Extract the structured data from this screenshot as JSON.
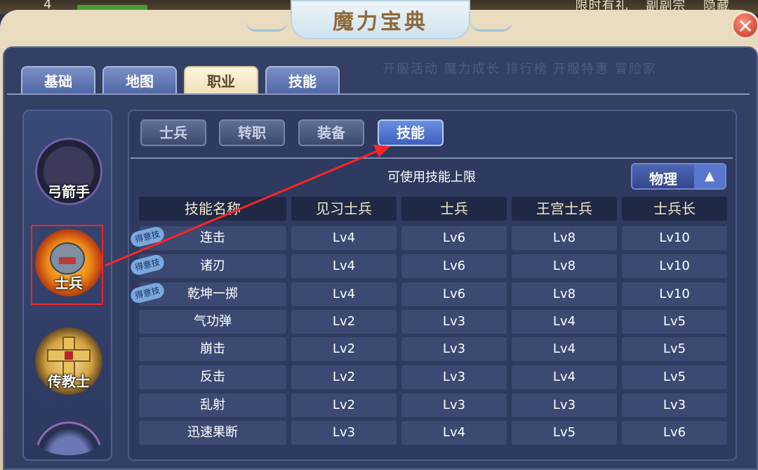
{
  "top_strip": {
    "number": "4",
    "menu": [
      "限时有礼",
      "副副宗",
      "隐藏"
    ]
  },
  "window": {
    "title": "魔力宝典",
    "close_glyph": "✕"
  },
  "faint_text": "开服活动 魔力成长 排行榜 开服特惠 冒险家",
  "tabs": [
    {
      "label": "基础",
      "active": false
    },
    {
      "label": "地图",
      "active": false
    },
    {
      "label": "职业",
      "active": true
    },
    {
      "label": "技能",
      "active": false
    }
  ],
  "jobs": [
    {
      "label": "弓箭手"
    },
    {
      "label": "士兵"
    },
    {
      "label": "传教士"
    }
  ],
  "subtabs": [
    {
      "label": "士兵",
      "active": false
    },
    {
      "label": "转职",
      "active": false
    },
    {
      "label": "装备",
      "active": false
    },
    {
      "label": "技能",
      "active": true
    }
  ],
  "skill_limit_title": "可使用技能上限",
  "filter": {
    "label": "物理",
    "arrow": "▲"
  },
  "badge_text": "得意技",
  "table": {
    "headers": [
      "技能名称",
      "见习士兵",
      "士兵",
      "王宫士兵",
      "士兵长"
    ],
    "rows": [
      {
        "name": "连击",
        "levels": [
          "Lv4",
          "Lv6",
          "Lv8",
          "Lv10"
        ],
        "signature": true
      },
      {
        "name": "诸刃",
        "levels": [
          "Lv4",
          "Lv6",
          "Lv8",
          "Lv10"
        ],
        "signature": true
      },
      {
        "name": "乾坤一掷",
        "levels": [
          "Lv4",
          "Lv6",
          "Lv8",
          "Lv10"
        ],
        "signature": true
      },
      {
        "name": "气功弹",
        "levels": [
          "Lv2",
          "Lv3",
          "Lv4",
          "Lv5"
        ],
        "signature": false
      },
      {
        "name": "崩击",
        "levels": [
          "Lv2",
          "Lv3",
          "Lv4",
          "Lv5"
        ],
        "signature": false
      },
      {
        "name": "反击",
        "levels": [
          "Lv2",
          "Lv3",
          "Lv4",
          "Lv5"
        ],
        "signature": false
      },
      {
        "name": "乱射",
        "levels": [
          "Lv2",
          "Lv3",
          "Lv3",
          "Lv3"
        ],
        "signature": false
      },
      {
        "name": "迅速果断",
        "levels": [
          "Lv3",
          "Lv4",
          "Lv5",
          "Lv6"
        ],
        "signature": false
      }
    ]
  },
  "colors": {
    "panel": "#334064",
    "active_tab": "#efdfb7",
    "active_subtab": "#3e5fbf",
    "annotation_red": "#ff2525"
  }
}
